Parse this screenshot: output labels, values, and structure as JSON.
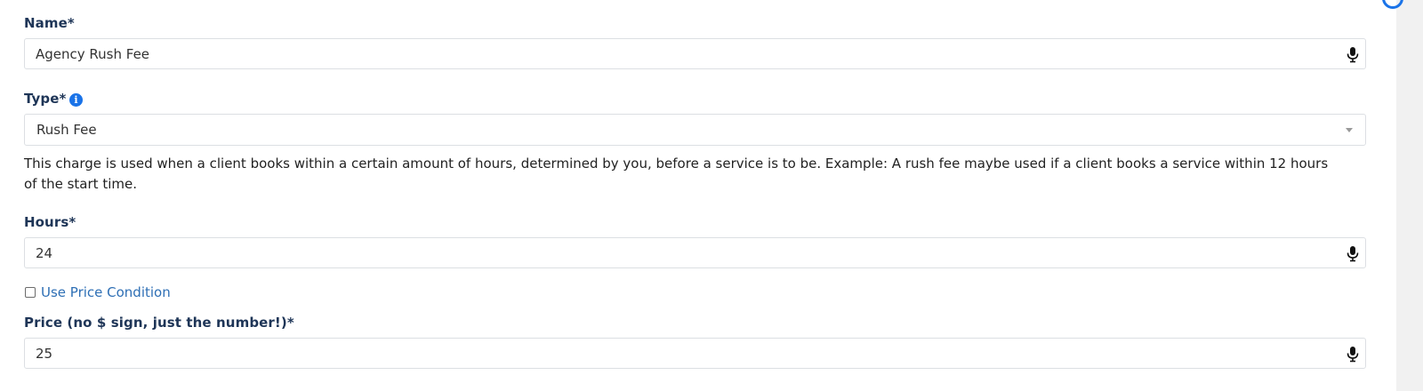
{
  "form": {
    "name": {
      "label": "Name*",
      "value": "Agency Rush Fee"
    },
    "type": {
      "label": "Type*",
      "info_icon": "i",
      "selected": "Rush Fee",
      "help_text": "This charge is used when a client books within a certain amount of hours, determined by you, before a service is to be. Example: A rush fee maybe used if a client books a service within 12 hours of the start time."
    },
    "hours": {
      "label": "Hours*",
      "value": "24"
    },
    "price_condition": {
      "label": "Use Price Condition",
      "checked": false
    },
    "price": {
      "label": "Price (no $ sign, just the number!)*",
      "value": "25"
    }
  },
  "icons": {
    "mic": "microphone-icon",
    "info": "info-icon",
    "caret": "caret-down-icon"
  },
  "colors": {
    "label": "#1e3557",
    "link": "#2e6fb5",
    "accent": "#1a73e8",
    "border": "#dcdfe3"
  }
}
